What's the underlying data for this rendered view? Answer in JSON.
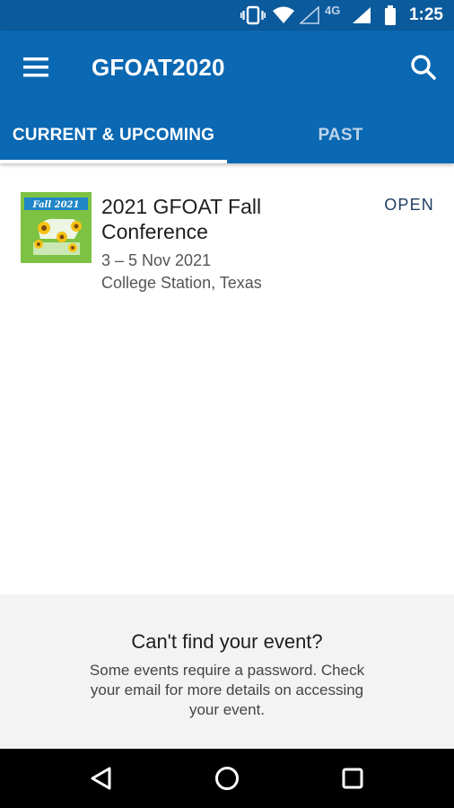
{
  "status_bar": {
    "time": "1:25",
    "network": "4G",
    "icons": [
      "vibrate-icon",
      "wifi-icon",
      "signal-empty-icon",
      "cell-signal-icon",
      "battery-icon"
    ]
  },
  "app_bar": {
    "title": "GFOAT2020",
    "menu_icon": "hamburger-menu-icon",
    "search_icon": "search-icon",
    "background": "#0b68b2"
  },
  "tabs": [
    {
      "label": "CURRENT & UPCOMING",
      "selected": true
    },
    {
      "label": "PAST",
      "selected": false
    }
  ],
  "events": [
    {
      "title": "2021 GFOAT Fall Conference",
      "dates": "3 – 5 Nov 2021",
      "location": "College Station, Texas",
      "status": "OPEN",
      "thumbnail": {
        "banner_text": "Fall 2021",
        "colors": [
          "#7dc242",
          "#1f86c8",
          "#f6c215"
        ]
      }
    }
  ],
  "help": {
    "title": "Can't find your event?",
    "text": "Some events require a password. Check your email for more details on accessing your event."
  },
  "nav_bar": {
    "buttons": [
      "back-icon",
      "home-icon",
      "recents-icon"
    ]
  }
}
